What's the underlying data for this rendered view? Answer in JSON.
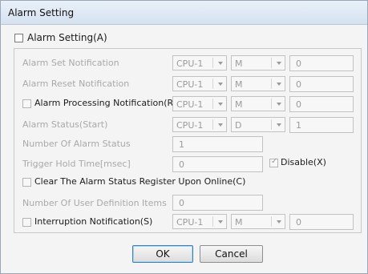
{
  "dialog": {
    "title": "Alarm Setting"
  },
  "main_checkbox": {
    "label": "Alarm Setting(A)",
    "checked": false
  },
  "rows": {
    "set_notification": {
      "label": "Alarm Set Notification",
      "cpu": "CPU-1",
      "device": "M",
      "value": "0"
    },
    "reset_notification": {
      "label": "Alarm Reset Notification",
      "cpu": "CPU-1",
      "device": "M",
      "value": "0"
    },
    "processing_notification": {
      "label": "Alarm Processing Notification(R)",
      "checked": false,
      "cpu": "CPU-1",
      "device": "M",
      "value": "0"
    },
    "status_start": {
      "label": "Alarm Status(Start)",
      "cpu": "CPU-1",
      "device": "D",
      "value": "1"
    },
    "number_of_status": {
      "label": "Number Of Alarm Status",
      "value": "1"
    },
    "trigger_hold_time": {
      "label": "Trigger Hold Time[msec]",
      "value": "0",
      "disable_label": "Disable(X)",
      "disable_checked": true
    },
    "clear_register": {
      "label": "Clear The Alarm Status Register Upon Online(C)",
      "checked": false
    },
    "user_definition_items": {
      "label": "Number Of User Definition Items",
      "value": "0"
    },
    "interruption_notification": {
      "label": "Interruption Notification(S)",
      "checked": false,
      "cpu": "CPU-1",
      "device": "M",
      "value": "0"
    }
  },
  "buttons": {
    "ok": "OK",
    "cancel": "Cancel"
  }
}
